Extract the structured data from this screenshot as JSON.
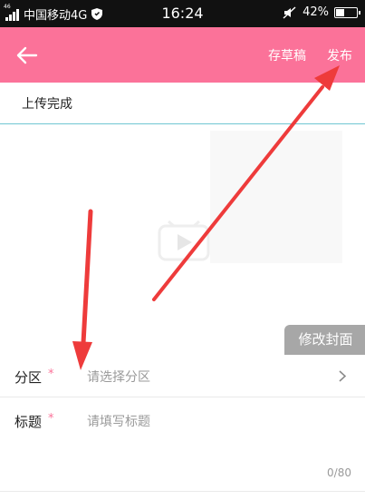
{
  "status_bar": {
    "network_tag": "46",
    "carrier": "中国移动4G",
    "time": "16:24",
    "battery": "42%",
    "battery_level": 0.42,
    "icons": [
      "signal-icon",
      "shield-icon",
      "mute-icon",
      "battery-icon"
    ]
  },
  "header": {
    "back_icon": "back-arrow-icon",
    "draft_label": "存草稿",
    "publish_label": "发布",
    "background": "#fb7299"
  },
  "upload": {
    "status_text": "上传完成"
  },
  "preview": {
    "play_icon": "play-icon",
    "change_cover_label": "修改封面"
  },
  "form": {
    "category": {
      "label": "分区",
      "required_mark": "*",
      "placeholder": "请选择分区",
      "chevron_icon": "chevron-right-icon"
    },
    "title": {
      "label": "标题",
      "required_mark": "*",
      "placeholder": "请填写标题",
      "counter": "0/80"
    }
  },
  "annotation_color": "#ee3b3b"
}
